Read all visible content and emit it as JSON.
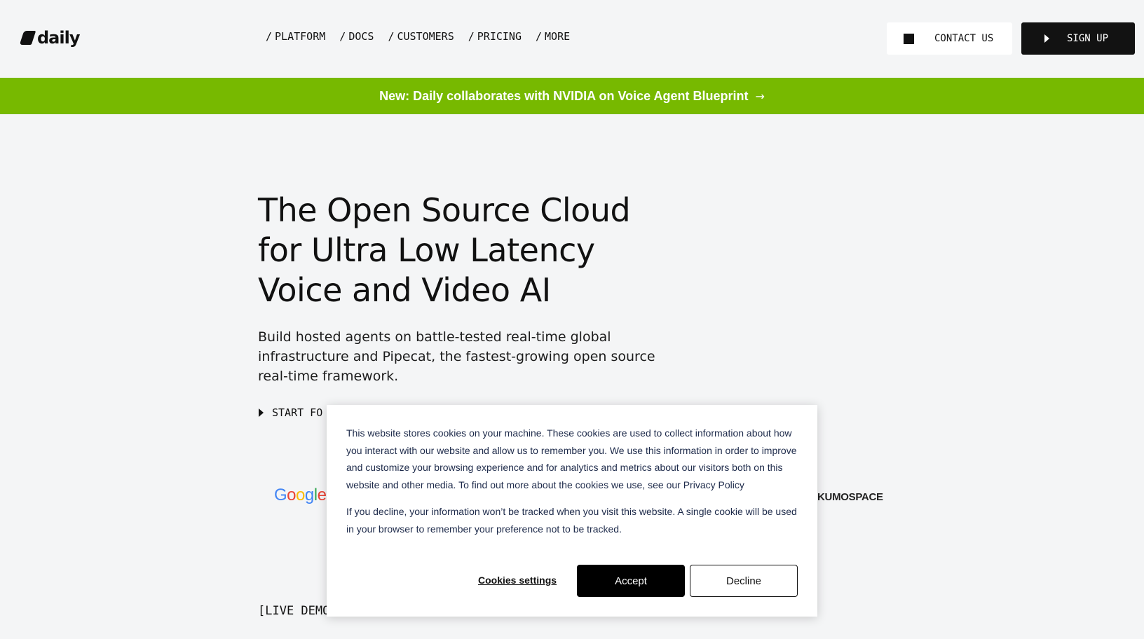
{
  "header": {
    "logo_text": "daily",
    "nav": [
      {
        "slash": "/",
        "label": "PLATFORM"
      },
      {
        "slash": "/",
        "label": "DOCS"
      },
      {
        "slash": "/",
        "label": "CUSTOMERS"
      },
      {
        "slash": "/",
        "label": "PRICING"
      },
      {
        "slash": "/",
        "label": "MORE"
      }
    ],
    "contact_label": "CONTACT US",
    "signup_label": "SIGN UP"
  },
  "banner": {
    "text": "New: Daily collaborates with NVIDIA on Voice Agent Blueprint",
    "arrow": "→",
    "color": "#77b900"
  },
  "hero": {
    "title": "The Open Source Cloud for Ultra Low Latency Voice and Video AI",
    "subtitle": "Build hosted agents on battle-tested real-time global infrastructure and Pipecat, the fastest-growing open source real-time framework.",
    "cta_label": "START FO"
  },
  "customer_logos": {
    "google": [
      "G",
      "o",
      "o",
      "g",
      "l",
      "e"
    ],
    "kumospace": "KUMOSPACE"
  },
  "live_demo_label": "[LIVE DEMO]",
  "cookie_banner": {
    "paragraph1": "This website stores cookies on your machine. These cookies are used to collect information about how you interact with our website and allow us to remember you. We use this information in order to improve and customize your browsing experience and for analytics and metrics about our visitors both on this website and other media. To find out more about the cookies we use, see our",
    "policy_link": "Privacy Policy",
    "paragraph2": "If you decline, your information won’t be tracked when you visit this website. A single cookie will be used in your browser to remember your preference not to be tracked.",
    "settings_label": "Cookies settings",
    "accept_label": "Accept",
    "decline_label": "Decline"
  }
}
